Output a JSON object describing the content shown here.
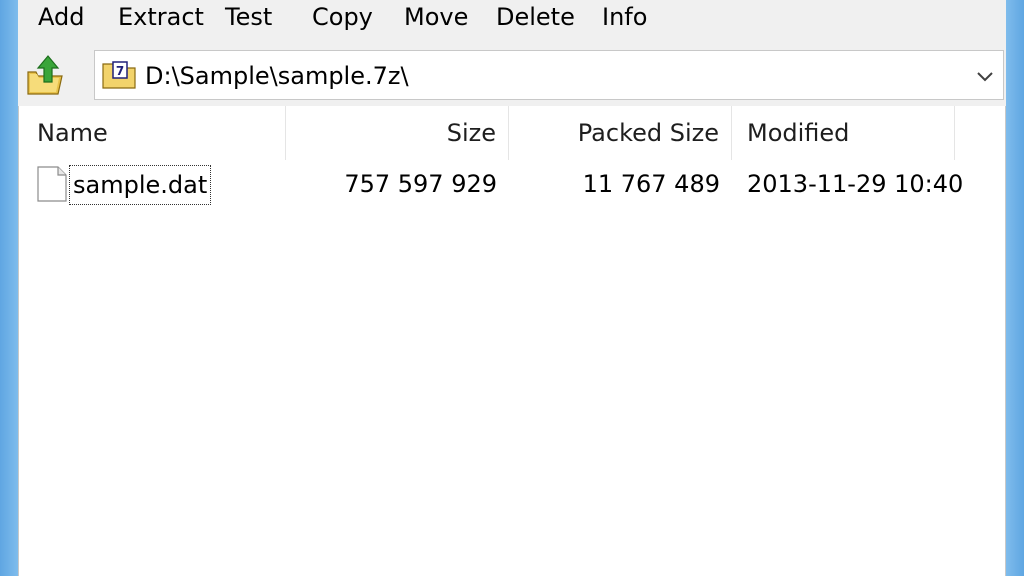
{
  "toolbar": {
    "add": "Add",
    "extract": "Extract",
    "test": "Test",
    "copy": "Copy",
    "move": "Move",
    "delete": "Delete",
    "info": "Info"
  },
  "address": {
    "path": "D:\\Sample\\sample.7z\\"
  },
  "columns": {
    "name": "Name",
    "size": "Size",
    "packed": "Packed Size",
    "modified": "Modified"
  },
  "files": [
    {
      "name": "sample.dat",
      "size": "757 597 929",
      "packed": "11 767 489",
      "modified": "2013-11-29 10:40"
    }
  ],
  "colors": {
    "frame": "#6cb0e8",
    "client": "#f0f0f0",
    "folder": "#f2d36b"
  },
  "icons": {
    "up": "folder-up-icon",
    "archive": "archive-icon",
    "dropdown": "chevron-down-icon",
    "file": "file-icon"
  }
}
